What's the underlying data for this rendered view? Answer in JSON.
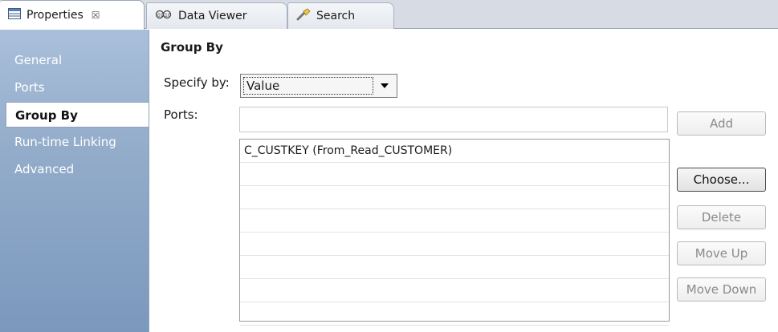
{
  "tabs": [
    {
      "label": "Properties",
      "icon": "properties-table-icon",
      "close": "☒"
    },
    {
      "label": "Data Viewer",
      "icon": "data-viewer-icon"
    },
    {
      "label": "Search",
      "icon": "search-flashlight-icon"
    }
  ],
  "sidebar": {
    "items": [
      {
        "label": "General"
      },
      {
        "label": "Ports"
      },
      {
        "label": "Group By"
      },
      {
        "label": "Run-time Linking"
      },
      {
        "label": "Advanced"
      }
    ],
    "selected": "Group By"
  },
  "main": {
    "title": "Group By",
    "specify_label": "Specify by:",
    "specify_value": "Value",
    "ports_label": "Ports:",
    "ports_input_value": "",
    "ports_list": [
      "C_CUSTKEY (From_Read_CUSTOMER)",
      "",
      "",
      "",
      "",
      "",
      "",
      ""
    ]
  },
  "buttons": {
    "add": "Add",
    "choose": "Choose...",
    "delete": "Delete",
    "move_up": "Move Up",
    "move_down": "Move Down"
  },
  "colors": {
    "sidebar_top": "#a9bfda",
    "sidebar_bottom": "#7b98bd",
    "tabbar_bg": "#d6dbe4"
  }
}
